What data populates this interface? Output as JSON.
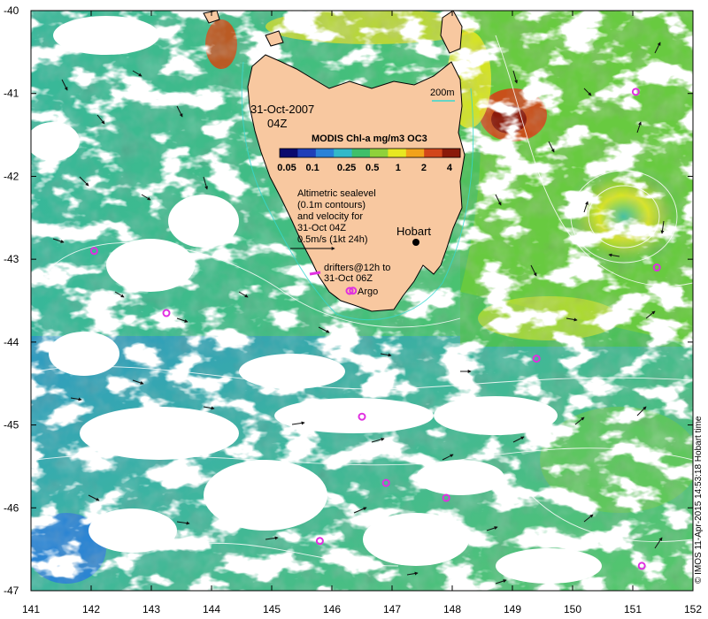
{
  "map": {
    "date_line1": "31-Oct-2007",
    "date_line2": "04Z",
    "colorbar_title": "MODIS Chl-a mg/m3 OC3",
    "colorbar_ticks": [
      "0.05",
      "0.1",
      "0.25",
      "0.5",
      "1",
      "2",
      "4"
    ],
    "colorbar_colors": [
      "#0a0a6e",
      "#1f3fb8",
      "#2a82d8",
      "#33b9c9",
      "#3fbf6a",
      "#8fd13a",
      "#e8e820",
      "#f2a21a",
      "#d2461a",
      "#8a1a0a"
    ],
    "isobath_label": "200m",
    "altimetry_text": [
      "Altimetric sealevel",
      "(0.1m contours)",
      "and velocity for",
      "31-Oct 04Z",
      "0.5m/s (1kt 24h)"
    ],
    "drifter_text": [
      "drifters@12h to",
      "31-Oct 06Z"
    ],
    "argo_label": "Argo",
    "city_label": "Hobart",
    "credit": "© IMOS 11-Apr-2015 14:53:18 Hobart time",
    "land_color": "#f8c8a0",
    "marker_color": "#e030e0",
    "axis": {
      "lon_ticks": [
        "141",
        "142",
        "143",
        "144",
        "145",
        "146",
        "147",
        "148",
        "149",
        "150",
        "151",
        "152"
      ],
      "lat_ticks": [
        "-40",
        "-41",
        "-42",
        "-43",
        "-44",
        "-45",
        "-46",
        "-47"
      ]
    },
    "argo_floats": [
      {
        "lon": 142.05,
        "lat": -42.9
      },
      {
        "lon": 143.25,
        "lat": -43.65
      },
      {
        "lon": 146.5,
        "lat": -44.9
      },
      {
        "lon": 146.9,
        "lat": -45.7
      },
      {
        "lon": 147.9,
        "lat": -45.88
      },
      {
        "lon": 145.8,
        "lat": -46.4
      },
      {
        "lon": 151.15,
        "lat": -46.7
      },
      {
        "lon": 151.4,
        "lat": -43.1
      },
      {
        "lon": 149.4,
        "lat": -44.2
      },
      {
        "lon": 151.05,
        "lat": -40.98
      },
      {
        "lon": 146.35,
        "lat": -43.38
      }
    ]
  }
}
